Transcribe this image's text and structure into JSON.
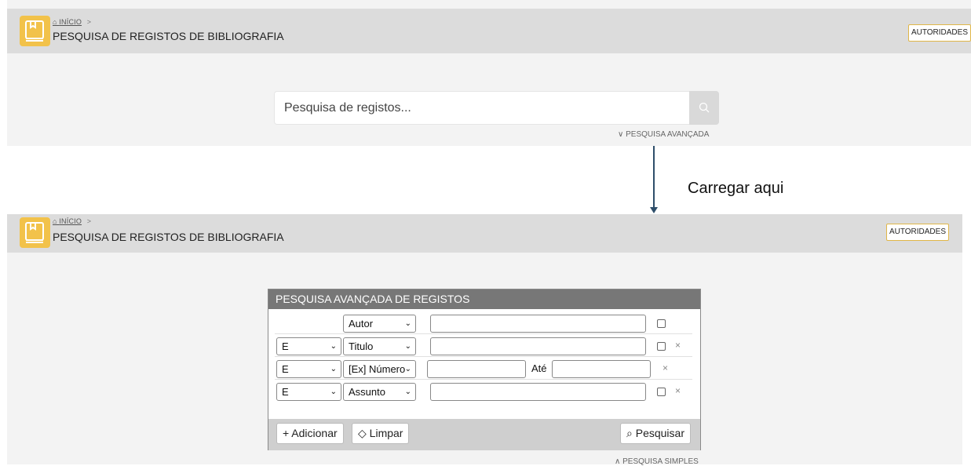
{
  "breadcrumb": {
    "home_icon": "home-icon",
    "home_label": "INÍCIO",
    "separator": ">"
  },
  "page_title": "PESQUISA DE REGISTOS DE BIBLIOGRAFIA",
  "authority_button": "AUTORIDADES",
  "simple_search": {
    "placeholder": "Pesquisa de registos...",
    "advanced_link": "∨ PESQUISA AVANÇADA"
  },
  "annotation": {
    "text": "Carregar aqui"
  },
  "advanced_search": {
    "title": "PESQUISA AVANÇADA DE REGISTOS",
    "rows": [
      {
        "operator": "",
        "field": "Autor",
        "value": ""
      },
      {
        "operator": "E",
        "field": "Titulo",
        "value": ""
      },
      {
        "operator": "E",
        "field": "[Ex] Número",
        "from": "",
        "to_label": "Até",
        "to": ""
      },
      {
        "operator": "E",
        "field": "Assunto",
        "value": ""
      }
    ],
    "remove_symbol": "×",
    "add_button": "+ Adicionar",
    "clear_button": "Limpar",
    "search_button": "Pesquisar",
    "simple_link": "∧ PESQUISA SIMPLES"
  },
  "colors": {
    "accent": "#f2c24a",
    "header_bg": "#dcdcdc",
    "panel_title_bg": "#777777",
    "arrow": "#2e4e6a"
  }
}
